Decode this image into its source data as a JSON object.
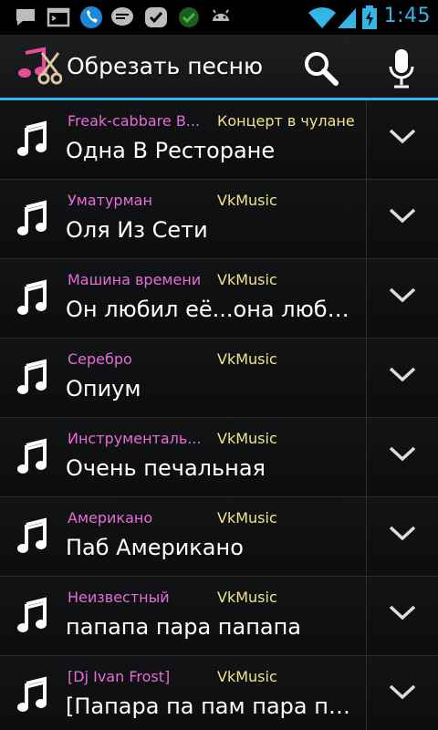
{
  "status_bar": {
    "time": "1:45",
    "notification_icons": [
      "chat-bubble-icon",
      "terminal-icon",
      "phone-icon",
      "talk-icon",
      "check-icon",
      "check-circle-icon",
      "android-icon"
    ],
    "system_icons": [
      "wifi-icon",
      "signal-icon",
      "battery-charging-icon"
    ]
  },
  "action_bar": {
    "title": "Обрезать песню",
    "logo_icon": "music-scissors-icon",
    "actions": [
      "search-icon",
      "microphone-icon"
    ],
    "accent_color": "#33b5e5"
  },
  "colors": {
    "artist": "#e76bd8",
    "album": "#efe588",
    "title": "#ffffff"
  },
  "songs": [
    {
      "artist": "Freak-cabbare B...",
      "album": "Концерт в чулане",
      "title": "Одна В Ресторане"
    },
    {
      "artist": "Уматурман",
      "album": "VkMusic",
      "title": "Оля Из Сети"
    },
    {
      "artist": "Машина времени",
      "album": "VkMusic",
      "title": "Он любил её...она люби..."
    },
    {
      "artist": "Серебро",
      "album": "VkMusic",
      "title": "Опиум"
    },
    {
      "artist": "Инструменталь...",
      "album": "VkMusic",
      "title": "Очень печальная"
    },
    {
      "artist": "Американо",
      "album": "VkMusic",
      "title": "Паб Американо"
    },
    {
      "artist": "Неизвестный",
      "album": "VkMusic",
      "title": "папапа пара папапа"
    },
    {
      "artist": "[Dj Ivan Frost]",
      "album": "VkMusic",
      "title": "[Папара па пам пара па..."
    }
  ]
}
